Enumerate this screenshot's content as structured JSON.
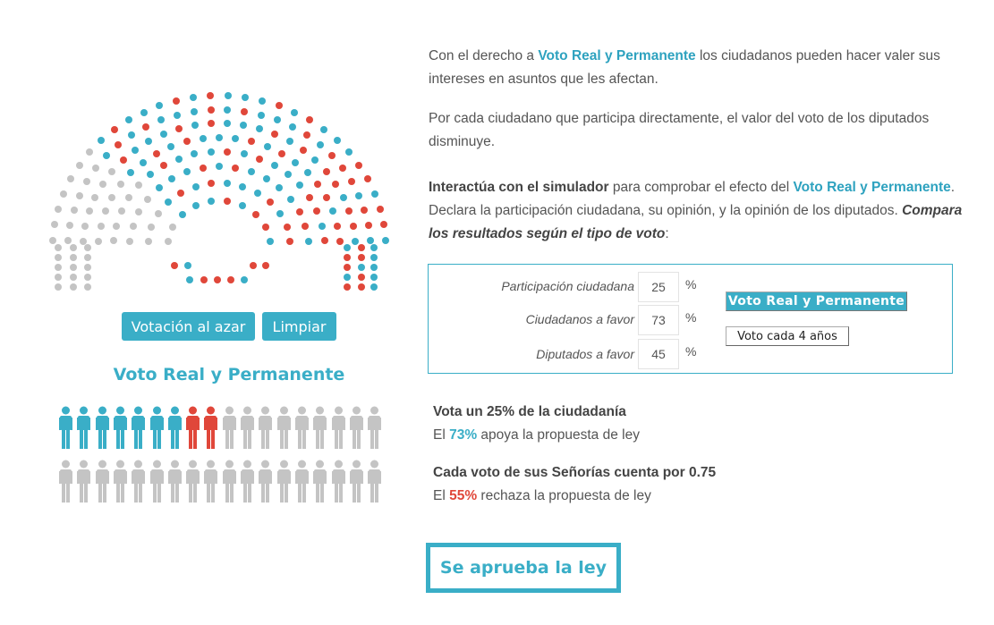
{
  "hemicycle": {
    "colors": {
      "red": "#e0473a",
      "blue": "#3aaec7",
      "gray": "#c4c4c4"
    }
  },
  "controls": {
    "random_label": "Votación al azar",
    "clear_label": "Limpiar"
  },
  "people": {
    "title": "Voto Real y Permanente",
    "participation_percent": 25,
    "favor_percent": 73,
    "total_figures": 36,
    "blue_figures": 7,
    "red_figures": 2
  },
  "intro": {
    "p1_a": "Con el derecho a ",
    "p1_hl": "Voto Real y Permanente",
    "p1_b": " los ciudadanos pueden hacer valer sus intereses en asuntos que les afectan.",
    "p2": "Por cada ciudadano que participa directamente, el valor del voto de los diputados disminuye.",
    "p3_strong": "Interactúa con el simulador",
    "p3_a": " para comprobar el efecto del ",
    "p3_hl": "Voto Real y Permanente",
    "p3_b": ". Declara la participación ciudadana, su opinión, y la opinión de los diputados.",
    "p3_em": "Compara los resultados según el tipo de voto",
    "p3_end": ":"
  },
  "simulator": {
    "participation_label": "Participación ciudadana",
    "participation_value": "25",
    "citizens_label": "Ciudadanos a favor",
    "citizens_value": "73",
    "deputies_label": "Diputados a favor",
    "deputies_value": "45",
    "percent_sign": "%",
    "vrp_button": "Voto Real y Permanente",
    "four_years_button": "Voto cada 4 años"
  },
  "results": {
    "line1": "Vota un 25% de la ciudadanía",
    "line2_a": "El ",
    "line2_pct": "73%",
    "line2_b": " apoya la propuesta de ley",
    "line3": "Cada voto de sus Señorías cuenta por 0.75",
    "line4_a": "El ",
    "line4_pct": "55%",
    "line4_b": " rechaza la propuesta de ley"
  },
  "outcome": "Se aprueba la ley"
}
